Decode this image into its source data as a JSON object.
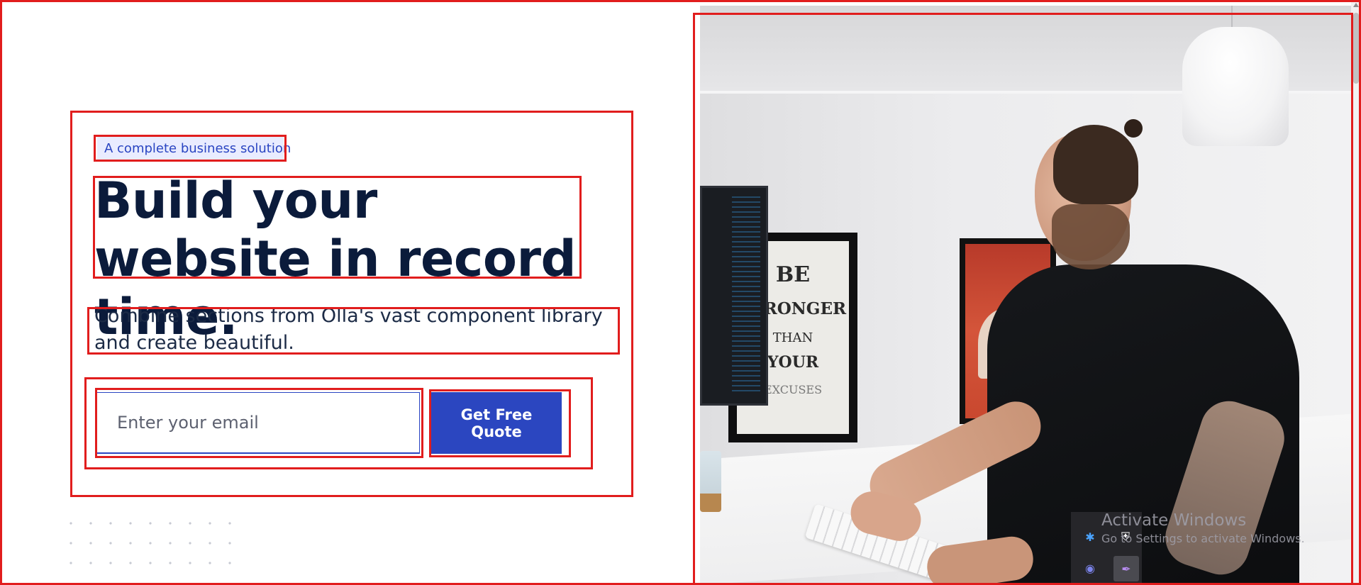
{
  "hero": {
    "badge": "A complete business solution",
    "headline": "Build your website in record time.",
    "subtext": "Combine sections from Olla's vast component library and create beautiful.",
    "email_placeholder": "Enter your email",
    "cta_label": "Get Free Quote"
  },
  "photo": {
    "poster_left_lines": [
      "BE",
      "STRONGER",
      "THAN",
      "YOUR",
      "EXCUSES"
    ]
  },
  "watermark": {
    "title": "Activate Windows",
    "subtitle": "Go to Settings to activate Windows."
  },
  "colors": {
    "brand": "#2b46c0",
    "badge_bg": "#e9ecff",
    "heading": "#0b1b3b",
    "annotation": "#e11d1d"
  },
  "icons": {
    "tray": [
      "bluetooth-icon",
      "security-shield-icon",
      "teams-icon",
      "feather-app-icon"
    ]
  }
}
